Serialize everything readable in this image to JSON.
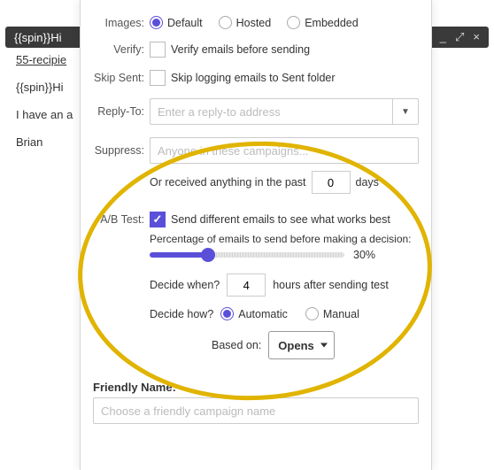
{
  "bg": {
    "header_title": "{{spin}}Hi",
    "list": [
      "55-recipie",
      "{{spin}}Hi",
      "I have an a",
      "Brian"
    ]
  },
  "labels": {
    "images": "Images:",
    "verify": "Verify:",
    "skip_sent": "Skip Sent:",
    "reply_to": "Reply-To:",
    "suppress": "Suppress:",
    "ab_test": "A/B Test:",
    "friendly_name": "Friendly Name:"
  },
  "images_options": {
    "default": "Default",
    "hosted": "Hosted",
    "embedded": "Embedded"
  },
  "verify_text": "Verify emails before sending",
  "skip_text": "Skip logging emails to Sent folder",
  "reply_placeholder": "Enter a reply-to address",
  "suppress_placeholder": "Anyone in these campaigns...",
  "suppress_days_prefix": "Or received anything in the past",
  "suppress_days_value": "0",
  "suppress_days_suffix": "days",
  "ab": {
    "send_diff": "Send different emails to see what works best",
    "percent_label": "Percentage of emails to send before making a decision:",
    "percent_value": "30%",
    "percent_pos": 30,
    "decide_when_label": "Decide when?",
    "decide_when_value": "4",
    "decide_when_suffix": "hours after sending test",
    "decide_how_label": "Decide how?",
    "automatic": "Automatic",
    "manual": "Manual",
    "based_on_label": "Based on:",
    "based_on_value": "Opens"
  },
  "friendly_placeholder": "Choose a friendly campaign name"
}
